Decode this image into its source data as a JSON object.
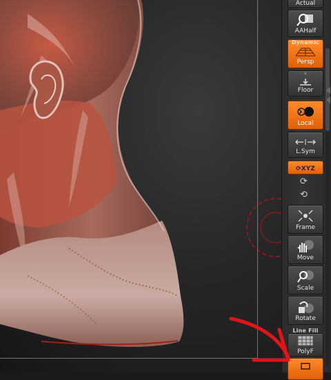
{
  "shelf": {
    "top_partial": "Actual",
    "aahalf": "AAHalf",
    "persp_tag": "Dynamic",
    "persp": "Persp",
    "floor": "Floor",
    "local": "Local",
    "lsym": "L.Sym",
    "xyz": "XYZ",
    "frame": "Frame",
    "move": "Move",
    "scale": "Scale",
    "rotate": "Rotate",
    "polyf_tag": "Line Fill",
    "polyf": "PolyF"
  },
  "colors": {
    "accent": "#f07a1a",
    "annotation_arrow": "#e0151a",
    "gizmo": "#b0141a"
  }
}
